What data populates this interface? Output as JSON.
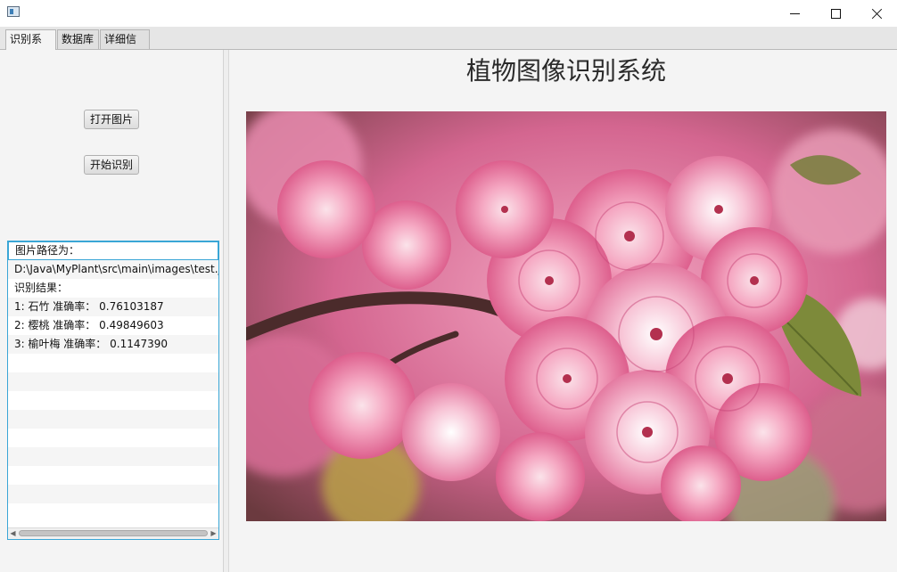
{
  "tabs": [
    {
      "label": "识别系统"
    },
    {
      "label": "数据库"
    },
    {
      "label": "详细信息"
    }
  ],
  "left": {
    "open_button": "打开图片",
    "start_button": "开始识别",
    "results": [
      "图片路径为：",
      "D:\\Java\\MyPlant\\src\\main\\images\\test.jpg",
      "识别结果：",
      "1: 石竹 准确率：  0.76103187",
      "2: 樱桃 准确率：  0.49849603",
      "3: 榆叶梅 准确率：  0.1147390"
    ]
  },
  "main": {
    "title": "植物图像识别系统"
  },
  "colors": {
    "accent": "#3aa6d6",
    "blossom": "#e87aa3"
  }
}
